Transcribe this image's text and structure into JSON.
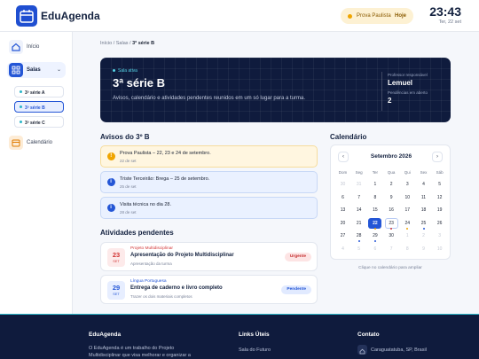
{
  "header": {
    "brand": "EduAgenda",
    "exam_label": "Prova Paulista",
    "exam_when": "Hoje",
    "time": "23:43",
    "date": "Ter, 22 set"
  },
  "sidebar": {
    "items": [
      {
        "label": "Início",
        "icon": "home-icon"
      },
      {
        "label": "Salas",
        "icon": "grid-icon"
      },
      {
        "label": "Calendário",
        "icon": "calendar-icon"
      }
    ],
    "rooms": [
      "3ª série A",
      "3ª série B",
      "3ª série C"
    ],
    "active_room": "3ª série B"
  },
  "breadcrumb": {
    "home": "Início",
    "sep1": "/",
    "salas": "Salas",
    "sep2": "/",
    "current": "3ª série B"
  },
  "hero": {
    "eyebrow": "Sala ativa",
    "title": "3ª série B",
    "subtitle": "Avisos, calendário e atividades pendentes reunidos em um só lugar para a turma.",
    "teacher_label": "Professor responsável",
    "teacher": "Lemuel",
    "pending_label": "Pendências em aberto",
    "pending": "2"
  },
  "notices": {
    "title": "Avisos do 3º B",
    "items": [
      {
        "type": "warn",
        "icon": "!",
        "text": "Prova Paulista – 22, 23 e 24 de setembro.",
        "date": "22 de set"
      },
      {
        "type": "info",
        "icon": "i",
        "text": "Triste Terceirão: Brega – 25 de setembro.",
        "date": "25 de set"
      },
      {
        "type": "info",
        "icon": "i",
        "text": "Visita técnica no dia 28.",
        "date": "28 de set"
      }
    ]
  },
  "activities": {
    "title": "Atividades pendentes",
    "items": [
      {
        "day": "23",
        "month": "SET",
        "subject": "Projeto Multidisciplinar",
        "title": "Apresentação do Projeto Multidisciplinar",
        "desc": "Apresentação da turma",
        "badge": "Urgente",
        "color": "red"
      },
      {
        "day": "29",
        "month": "SET",
        "subject": "Língua Portuguesa",
        "title": "Entrega de caderno e livro completo",
        "desc": "Trazer os dois materiais completos",
        "badge": "Pendente",
        "color": "blue"
      }
    ]
  },
  "calendar": {
    "title": "Calendário",
    "month": "Setembro 2026",
    "prev": "‹",
    "next": "›",
    "weekdays": [
      "Dom",
      "Seg",
      "Ter",
      "Qua",
      "Qui",
      "Sex",
      "Sáb"
    ],
    "days": [
      "30",
      "31",
      "1",
      "2",
      "3",
      "4",
      "5",
      "6",
      "7",
      "8",
      "9",
      "10",
      "11",
      "12",
      "13",
      "14",
      "15",
      "16",
      "17",
      "18",
      "19",
      "20",
      "21",
      "22",
      "23",
      "24",
      "25",
      "26",
      "27",
      "28",
      "29",
      "30",
      "1",
      "2",
      "3",
      "4",
      "5",
      "6",
      "7",
      "8",
      "9",
      "10"
    ],
    "muted": [
      0,
      1,
      32,
      33,
      34,
      35,
      36,
      37,
      38,
      39,
      40,
      41
    ],
    "today": 23,
    "ring": [
      24
    ],
    "events": [
      {
        "day_index": 23,
        "color": "#f0a500"
      },
      {
        "day_index": 24,
        "color": "#d23434"
      },
      {
        "day_index": 25,
        "color": "#f0a500"
      },
      {
        "day_index": 26,
        "color": "#2456d6"
      },
      {
        "day_index": 29,
        "color": "#2456d6"
      },
      {
        "day_index": 30,
        "color": "#2456d6"
      }
    ],
    "hint": "Clique no calendário para ampliar"
  },
  "footer": {
    "brand": "EduAgenda",
    "about": "O EduAgenda é um trabalho do Projeto Multidisciplinar que visa melhorar e organizar a rotina escolar para alunos",
    "links_title": "Links Úteis",
    "link1": "Sala do Futuro",
    "contact_title": "Contato",
    "location": "Caraguatatuba, SP, Brasil"
  }
}
